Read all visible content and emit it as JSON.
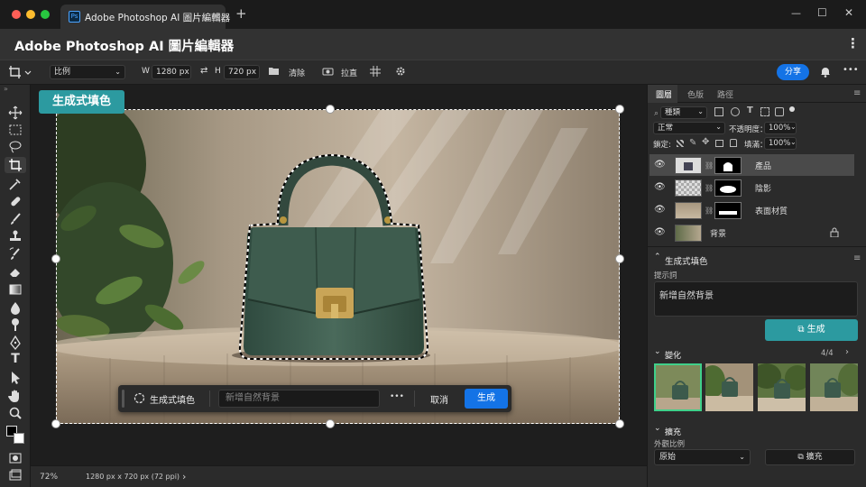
{
  "tab": {
    "app_badge": "Ps",
    "title": "Adobe Photoshop AI 圖片編輯器",
    "close": "✕",
    "new": "+"
  },
  "window": {
    "minimize": "—",
    "maximize": "☐",
    "close": "✕"
  },
  "app": {
    "title": "Adobe Photoshop AI 圖片編輯器",
    "menu": "⋮"
  },
  "options": {
    "ratio_label": "比例",
    "w_label": "W",
    "w_value": "1280 px",
    "h_label": "H",
    "h_value": "720 px",
    "clear_label": "清除",
    "straighten_label": "拉直",
    "share_label": "分享"
  },
  "canvas": {
    "gen_label": "生成式填色",
    "ctx": {
      "label": "生成式填色",
      "placeholder": "新增自然背景",
      "more": "•••",
      "cancel": "取消",
      "generate": "生成"
    }
  },
  "status": {
    "zoom": "72%",
    "size_info": "1280 px x 720 px (72 ppi)",
    "arrow": "›"
  },
  "panel": {
    "tabs": [
      "圖層",
      "色版",
      "路徑"
    ],
    "kind_filter": "種類",
    "blend_mode": "正常",
    "opacity_label": "不透明度：",
    "opacity_value": "100%",
    "lock_label": "鎖定:",
    "fill_label": "填滿：",
    "fill_value": "100%",
    "layers": [
      {
        "name": "產品",
        "selected": true
      },
      {
        "name": "陰影",
        "selected": false
      },
      {
        "name": "表面材質",
        "selected": false
      },
      {
        "name": "背景",
        "selected": false
      }
    ],
    "genfill": {
      "title": "生成式填色",
      "prompt_label": "提示詞",
      "prompt_value": "新增自然背景",
      "generate": "生成",
      "variations_label": "變化",
      "variations_count": "4/4",
      "expand_label": "擴充",
      "aspect_label": "外觀比例",
      "aspect_value": "原始",
      "expand_button": "擴充"
    }
  },
  "colors": {
    "accent_teal": "#2c9aa0",
    "accent_blue": "#1473e6",
    "bag_green": "#3c5a4c"
  }
}
